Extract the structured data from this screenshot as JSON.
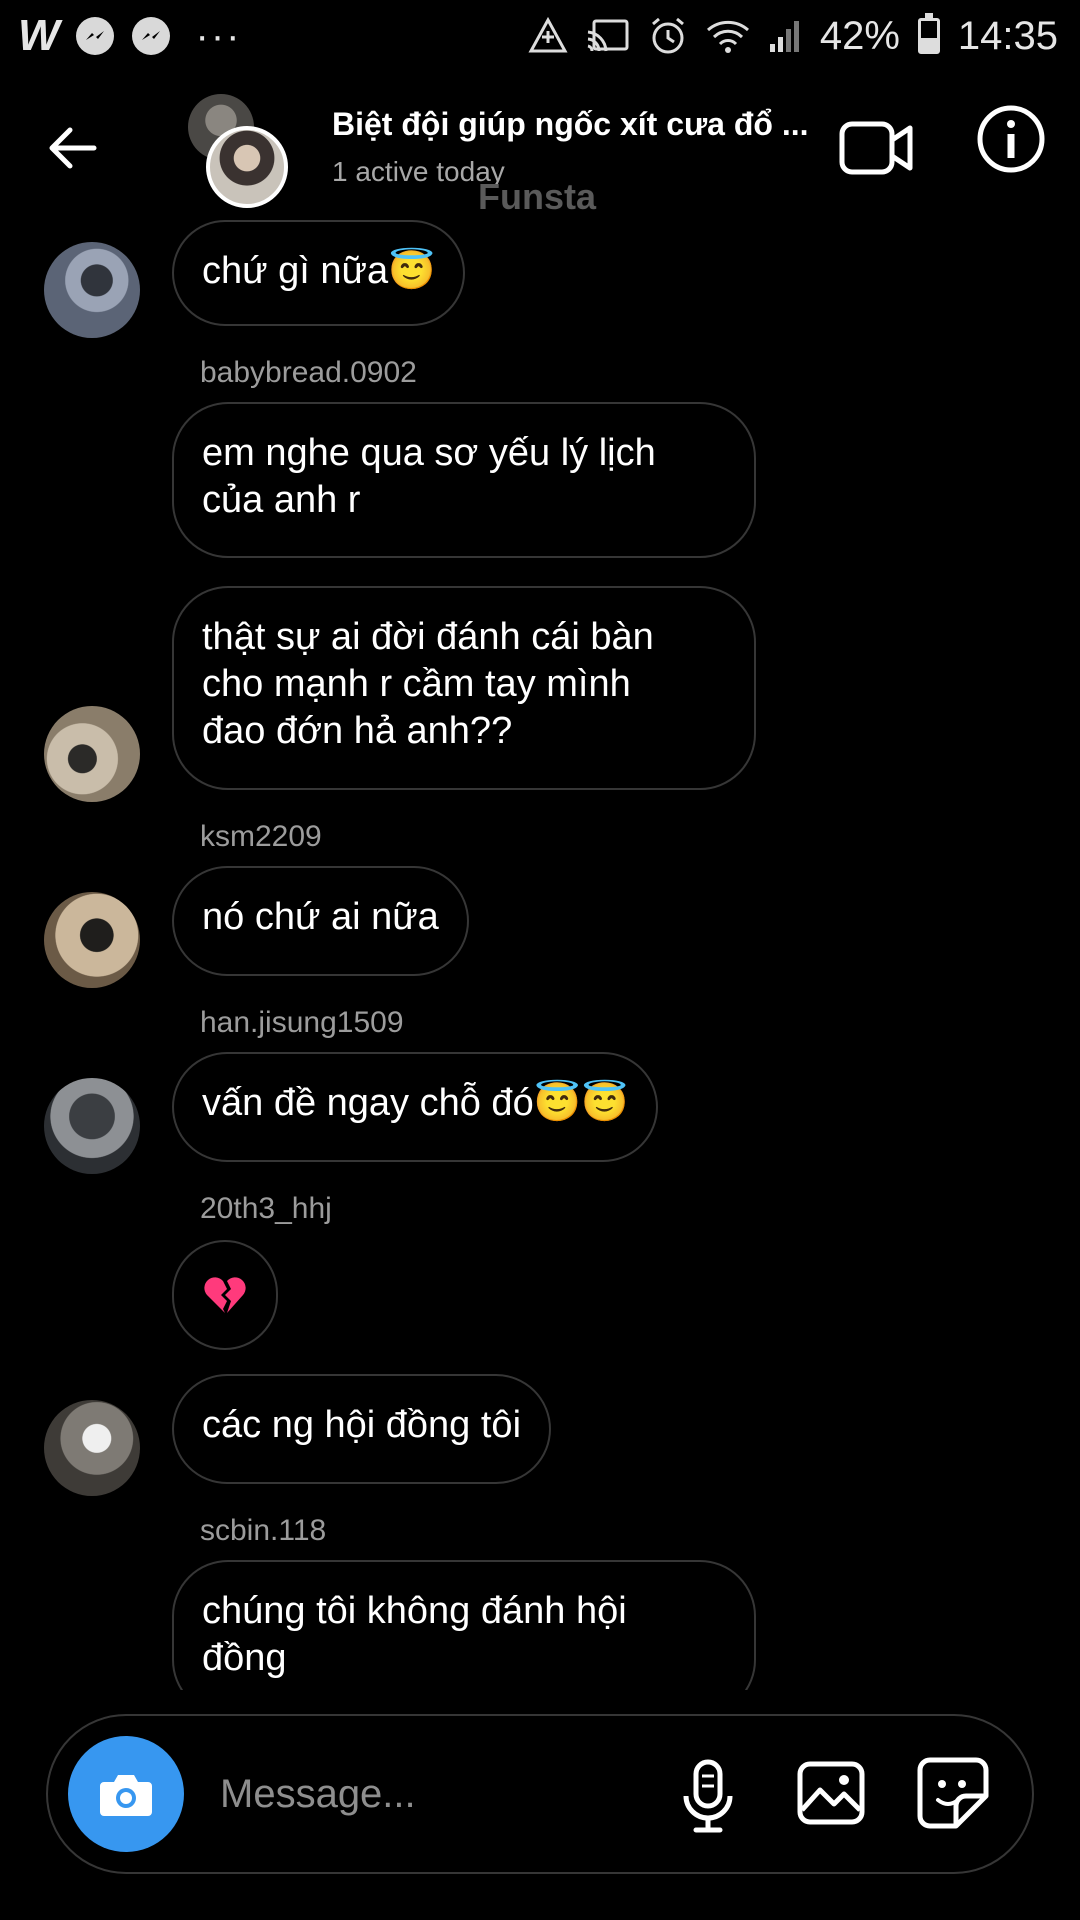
{
  "status_bar": {
    "left_app_letter": "W",
    "more_dots": "···",
    "battery": "42%",
    "time": "14:35",
    "icons": [
      "w-app-icon",
      "messenger-icon",
      "messenger-icon",
      "data-saver-icon",
      "cast-icon",
      "alarm-icon",
      "wifi-icon",
      "signal-icon",
      "battery-icon"
    ]
  },
  "header": {
    "title": "Biệt đội giúp ngốc xít cưa đổ ...",
    "subtitle": "1 active today",
    "overlay_text": "Funsta",
    "icons": [
      "back-arrow-icon",
      "video-call-icon",
      "info-icon"
    ]
  },
  "messages": [
    {
      "sender": "",
      "text": "chứ gì nữa😇",
      "avatar": true
    },
    {
      "sender": "babybread.0902",
      "text": "em nghe qua sơ yếu lý lịch\ncủa anh r",
      "avatar": false
    },
    {
      "sender": "",
      "text": "thật sự ai đời đánh cái bàn\ncho mạnh r cầm tay mình\nđao đớn hả anh??",
      "avatar": true
    },
    {
      "sender": "ksm2209",
      "text": "nó chứ ai nữa",
      "avatar": true
    },
    {
      "sender": "han.jisung1509",
      "text": "vấn đề ngay chỗ đó😇😇",
      "avatar": true
    },
    {
      "sender": "20th3_hhj",
      "text": "💔",
      "avatar": false
    },
    {
      "sender": "",
      "text": "các ng hội đồng tôi",
      "avatar": true
    },
    {
      "sender": "scbin.118",
      "text": "chúng tôi không đánh hội\nđồng",
      "avatar": false
    }
  ],
  "composer": {
    "placeholder": "Message...",
    "icons": [
      "camera-icon",
      "microphone-icon",
      "photo-gallery-icon",
      "sticker-icon"
    ]
  },
  "colors": {
    "background": "#000000",
    "bubble_border": "#363636",
    "camera_button": "#3797f0",
    "secondary_text": "#a8a8a8"
  }
}
